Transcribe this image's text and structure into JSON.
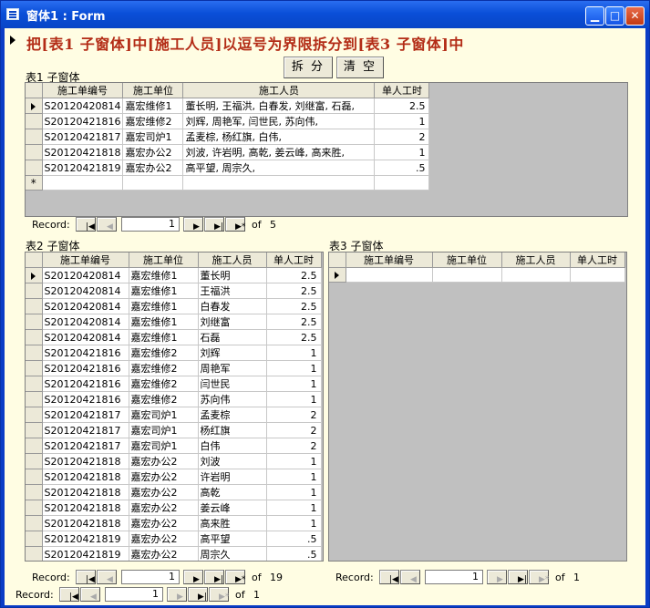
{
  "window": {
    "title": "窗体1 : Form"
  },
  "heading": "把[表1 子窗体]中[施工人员]以逗号为界限拆分到[表3 子窗体]中",
  "buttons": {
    "split": "拆 分",
    "clear": "清 空"
  },
  "nav": {
    "record_label": "Record:",
    "of_label": "of"
  },
  "table1": {
    "label": "表1 子窗体",
    "columns": [
      "施工单编号",
      "施工单位",
      "施工人员",
      "单人工时"
    ],
    "rows": [
      [
        "S20120420814",
        "嘉宏维修1",
        "董长明, 王福洪, 白春发, 刘继富, 石磊,",
        "2.5"
      ],
      [
        "S20120421816",
        "嘉宏维修2",
        "刘辉, 周艳军, 闫世民, 苏向伟,",
        "1"
      ],
      [
        "S20120421817",
        "嘉宏司炉1",
        "孟麦棕, 杨红旗, 白伟,",
        "2"
      ],
      [
        "S20120421818",
        "嘉宏办公2",
        "刘波, 许岩明, 高乾, 姜云峰, 高来胜,",
        "1"
      ],
      [
        "S20120421819",
        "嘉宏办公2",
        "高平望, 周宗久,",
        ".5"
      ]
    ],
    "current_record": "1",
    "total_records": "5"
  },
  "table2": {
    "label": "表2 子窗体",
    "columns": [
      "施工单编号",
      "施工单位",
      "施工人员",
      "单人工时"
    ],
    "rows": [
      [
        "S20120420814",
        "嘉宏维修1",
        "董长明",
        "2.5"
      ],
      [
        "S20120420814",
        "嘉宏维修1",
        "王福洪",
        "2.5"
      ],
      [
        "S20120420814",
        "嘉宏维修1",
        "白春发",
        "2.5"
      ],
      [
        "S20120420814",
        "嘉宏维修1",
        "刘继富",
        "2.5"
      ],
      [
        "S20120420814",
        "嘉宏维修1",
        "石磊",
        "2.5"
      ],
      [
        "S20120421816",
        "嘉宏维修2",
        "刘辉",
        "1"
      ],
      [
        "S20120421816",
        "嘉宏维修2",
        "周艳军",
        "1"
      ],
      [
        "S20120421816",
        "嘉宏维修2",
        "闫世民",
        "1"
      ],
      [
        "S20120421816",
        "嘉宏维修2",
        "苏向伟",
        "1"
      ],
      [
        "S20120421817",
        "嘉宏司炉1",
        "孟麦棕",
        "2"
      ],
      [
        "S20120421817",
        "嘉宏司炉1",
        "杨红旗",
        "2"
      ],
      [
        "S20120421817",
        "嘉宏司炉1",
        "白伟",
        "2"
      ],
      [
        "S20120421818",
        "嘉宏办公2",
        "刘波",
        "1"
      ],
      [
        "S20120421818",
        "嘉宏办公2",
        "许岩明",
        "1"
      ],
      [
        "S20120421818",
        "嘉宏办公2",
        "高乾",
        "1"
      ],
      [
        "S20120421818",
        "嘉宏办公2",
        "姜云峰",
        "1"
      ],
      [
        "S20120421818",
        "嘉宏办公2",
        "高来胜",
        "1"
      ],
      [
        "S20120421819",
        "嘉宏办公2",
        "高平望",
        ".5"
      ],
      [
        "S20120421819",
        "嘉宏办公2",
        "周宗久",
        ".5"
      ]
    ],
    "current_record": "1",
    "total_records": "19"
  },
  "table3": {
    "label": "表3 子窗体",
    "columns": [
      "施工单编号",
      "施工单位",
      "施工人员",
      "单人工时"
    ],
    "rows": [],
    "current_record": "1",
    "total_records": "1"
  },
  "main_nav": {
    "current_record": "1",
    "total_records": "1"
  }
}
